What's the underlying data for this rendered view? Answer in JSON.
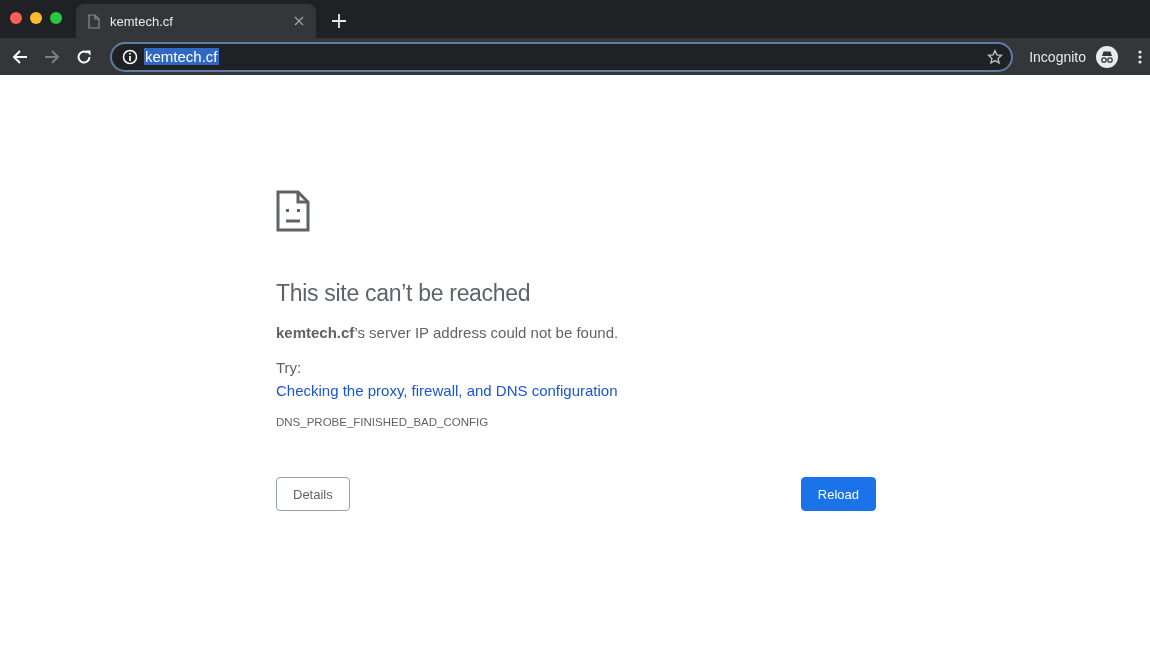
{
  "tabs": [
    {
      "title": "kemtech.cf",
      "selected": true
    }
  ],
  "toolbar": {
    "back_disabled": false,
    "forward_disabled": true
  },
  "address_bar": {
    "value": "kemtech.cf",
    "text_selected": true
  },
  "profile": {
    "label": "Incognito"
  },
  "error": {
    "heading": "This site can’t be reached",
    "message": "**kemtech.cf**’s server IP address could not be found.",
    "try_label": "Try:",
    "suggestion_link": "Checking the proxy, firewall, and DNS configuration",
    "code": "DNS_PROBE_FINISHED_BAD_CONFIG"
  },
  "buttons": [
    {
      "label": "Details",
      "kind": "secondary"
    },
    {
      "label": "Reload",
      "kind": "primary"
    }
  ]
}
